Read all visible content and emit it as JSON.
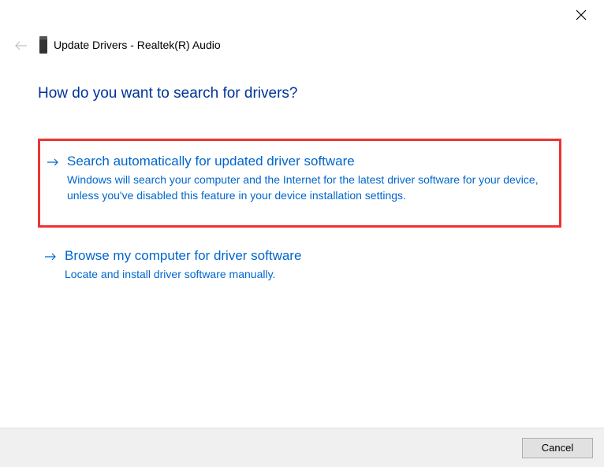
{
  "header": {
    "title": "Update Drivers - Realtek(R) Audio"
  },
  "main": {
    "heading": "How do you want to search for drivers?"
  },
  "options": [
    {
      "title": "Search automatically for updated driver software",
      "description": "Windows will search your computer and the Internet for the latest driver software for your device, unless you've disabled this feature in your device installation settings."
    },
    {
      "title": "Browse my computer for driver software",
      "description": "Locate and install driver software manually."
    }
  ],
  "footer": {
    "cancel_label": "Cancel"
  }
}
